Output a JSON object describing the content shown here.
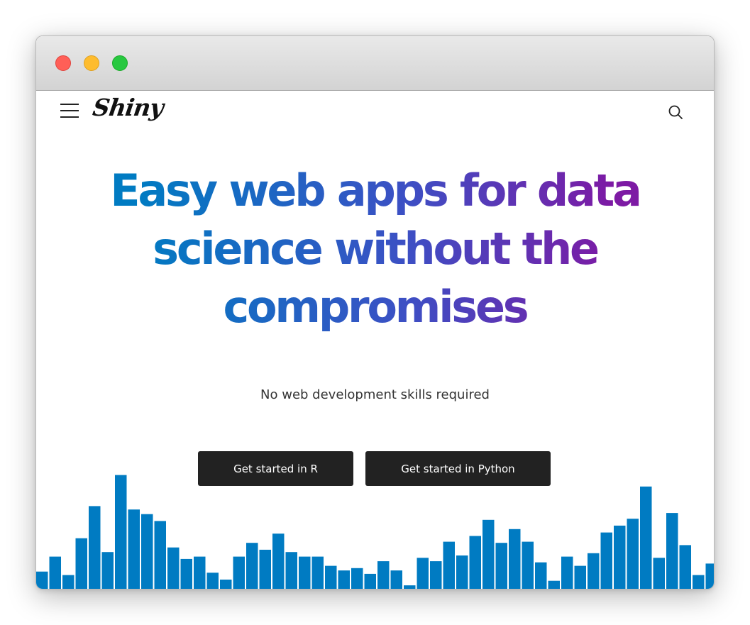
{
  "window": {
    "colors": {
      "close": "#ff5f57",
      "minimize": "#febc2e",
      "maximize": "#28c840"
    }
  },
  "navbar": {
    "menu_icon": "hamburger-icon",
    "logo_text": "Shiny",
    "search_icon": "search-icon"
  },
  "hero": {
    "headline": "Easy web apps for data science without the compromises",
    "subtitle": "No web development skills required",
    "gradient_colors": [
      "#007bc2",
      "#3d4fc4",
      "#7d1aa4"
    ]
  },
  "buttons": {
    "r_label": "Get started in R",
    "python_label": "Get started in Python"
  },
  "decoration": {
    "bar_color": "#007bc2",
    "bar_levels": [
      0.15,
      0.28,
      0.12,
      0.44,
      0.72,
      0.32,
      0.99,
      0.69,
      0.65,
      0.59,
      0.36,
      0.26,
      0.28,
      0.14,
      0.08,
      0.28,
      0.4,
      0.34,
      0.48,
      0.32,
      0.28,
      0.28,
      0.2,
      0.16,
      0.18,
      0.13,
      0.24,
      0.16,
      0.03,
      0.27,
      0.24,
      0.41,
      0.29,
      0.46,
      0.6,
      0.4,
      0.52,
      0.41,
      0.23,
      0.07,
      0.28,
      0.2,
      0.31,
      0.49,
      0.55,
      0.61,
      0.89,
      0.27,
      0.66,
      0.38,
      0.12,
      0.22
    ]
  }
}
